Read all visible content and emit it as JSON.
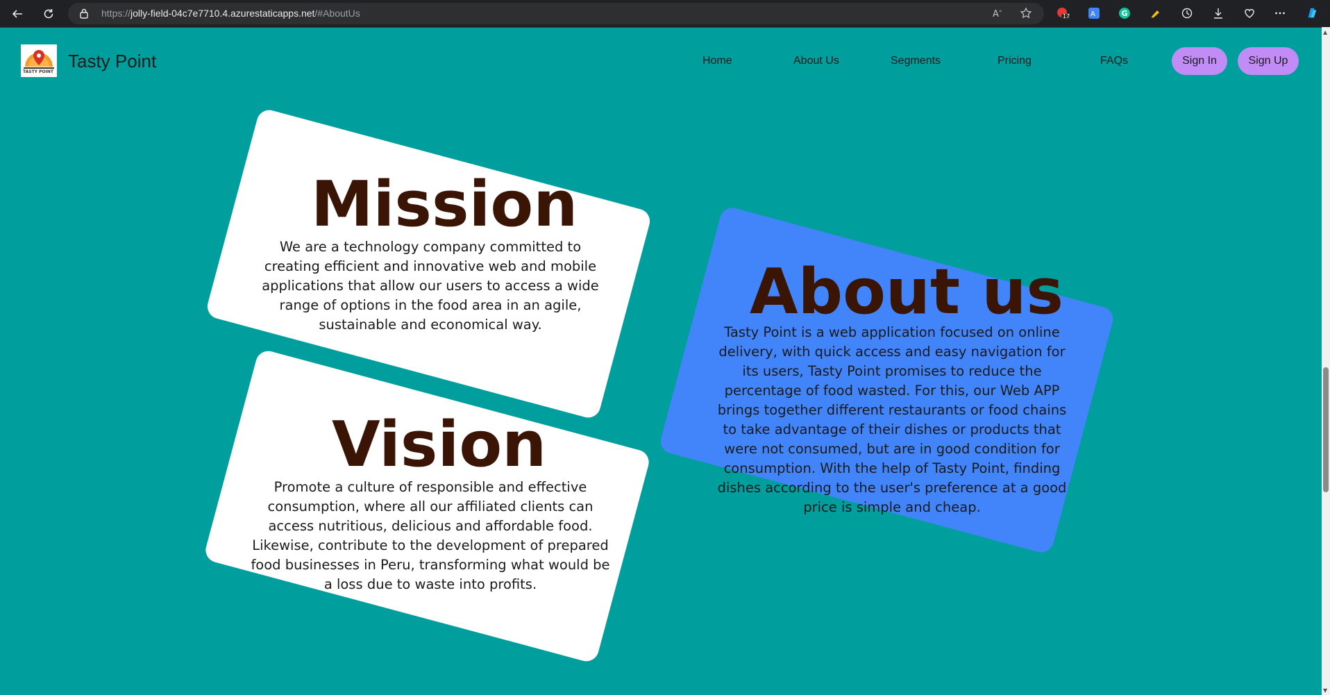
{
  "browser": {
    "url_prefix": "https://",
    "url_host": "jolly-field-04c7e7710.4.azurestaticapps.net",
    "url_path": "/#AboutUs",
    "extension_badge": "17"
  },
  "header": {
    "brand": "Tasty Point",
    "logo_text": "TASTY POINT",
    "nav": [
      {
        "label": "Home"
      },
      {
        "label": "About Us"
      },
      {
        "label": "Segments"
      },
      {
        "label": "Pricing"
      },
      {
        "label": "FAQs"
      }
    ],
    "sign_in": "Sign In",
    "sign_up": "Sign Up"
  },
  "mission": {
    "title": "Mission",
    "text": "We are a technology company committed to creating efficient and innovative web and mobile applications that allow our users to access a wide range of options in the food area in an agile, sustainable and economical way."
  },
  "vision": {
    "title": "Vision",
    "text": "Promote a culture of responsible and effective consumption, where all our affiliated clients can access nutritious, delicious and affordable food. Likewise, contribute to the development of prepared food businesses in Peru, transforming what would be a loss due to waste into profits."
  },
  "about": {
    "title": "About us",
    "text": "Tasty Point is a web application focused on online delivery, with quick access and easy navigation for its users, Tasty Point promises to reduce the percentage of food wasted. For this, our Web APP brings together different restaurants or food chains to take advantage of their dishes or products that were not consumed, but are in good condition for consumption. With the help of Tasty Point, finding dishes according to the user's preference at a good price is simple and cheap."
  },
  "colors": {
    "page_background": "#009e9c",
    "card_white": "#ffffff",
    "card_blue": "#4285fb",
    "heading": "#3a1505",
    "button_purple": "#c18cf5"
  },
  "icons": [
    "back-icon",
    "refresh-icon",
    "lock-icon",
    "read-aloud-icon",
    "favorite-star-icon",
    "history-icon",
    "download-icon",
    "health-icon",
    "more-icon",
    "copilot-icon"
  ]
}
